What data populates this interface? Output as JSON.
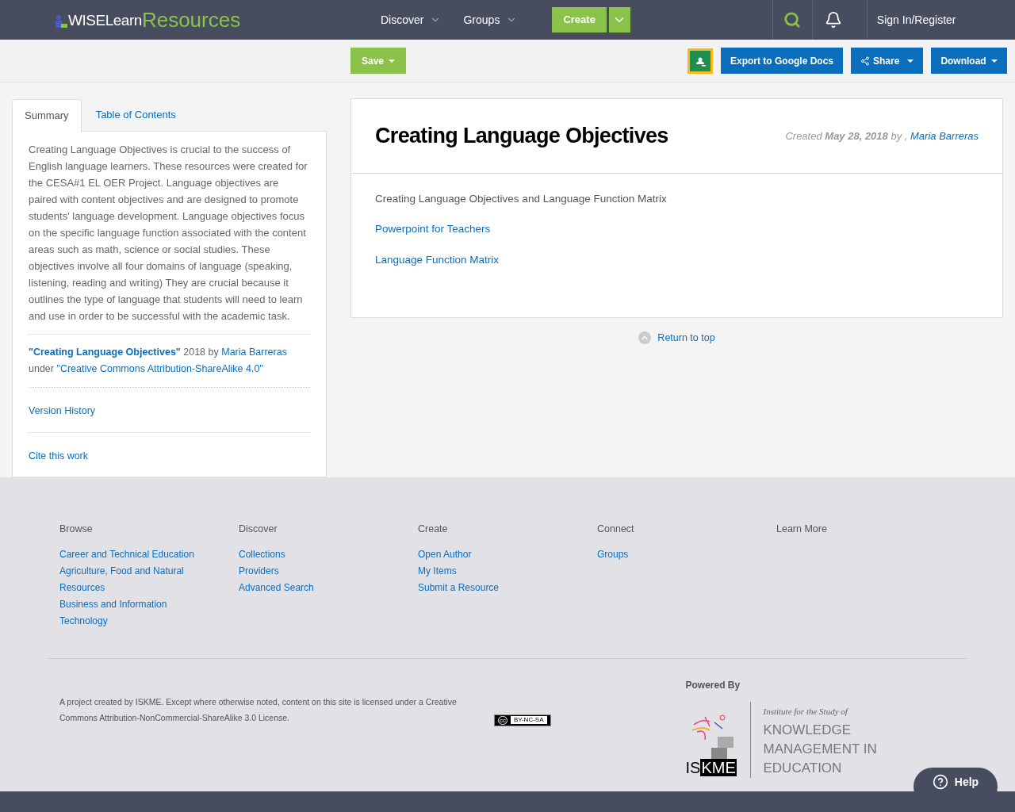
{
  "header": {
    "logo": {
      "part_1": "WISELearn",
      "part_2": "Resources"
    },
    "nav": [
      {
        "label": "Discover"
      },
      {
        "label": "Groups"
      }
    ],
    "create": "Create",
    "sign_in": "Sign In/Register"
  },
  "toolbar": {
    "save": "Save",
    "export": "Export to Google Docs",
    "share": "Share",
    "download": "Download"
  },
  "sidebar": {
    "tabs": [
      {
        "label": "Summary",
        "selected": true
      },
      {
        "label": "Table of Contents",
        "selected": false
      }
    ],
    "summary": "Creating Language Objectives is crucial to the success of English language learners. These resources were created for the CESA#1 EL OER Project. Language objectives are paired with content objectives and are designed to promote students' language development. Language objectives focus on the specific language function associated with the content areas such as math, science or social studies. These objectives involve all four domains of language (speaking, listening, reading and writing) They are crucial because it outlines the type of language that students will need to learn and use in order to be successful with the academic task.",
    "attribution": {
      "title": "\"Creating Language Objectives\"",
      "year_by": "2018 by",
      "author": "Maria Barreras",
      "under": "under",
      "license": "\"Creative Commons Attribution-ShareAlike 4.0\""
    },
    "links": [
      "Version History",
      "Cite this work"
    ]
  },
  "resource": {
    "title": "Creating Language Objectives",
    "created": "Created",
    "date": "May 28, 2018",
    "by": "by ,",
    "author": "Maria Barreras",
    "description": "Creating Language Objectives and Language Function Matrix",
    "links": [
      "Powerpoint for Teachers",
      "Language Function Matrix"
    ],
    "return_to_top": "Return to top"
  },
  "footer": {
    "columns": [
      {
        "heading": "Browse",
        "links": [
          "Career and Technical Education",
          "Agriculture, Food and Natural Resources",
          "Business and Information Technology"
        ]
      },
      {
        "heading": "Discover",
        "links": [
          "Collections",
          "Providers",
          "Advanced Search"
        ]
      },
      {
        "heading": "Create",
        "links": [
          "Open Author",
          "My Items",
          "Submit a Resource"
        ]
      },
      {
        "heading": "Connect",
        "links": [
          "Groups"
        ]
      },
      {
        "heading": "Learn More"
      }
    ],
    "license_text": "A project created by ISKME. Except where otherwise noted, content on this site is licensed under a Creative Commons Attribution-NonCommercial-ShareAlike 3.0 License.",
    "cc_badge": {
      "cc": "cc",
      "terms": "BY-NC-SA"
    },
    "powered_by": "Powered By",
    "iskme": {
      "mark_1": "IS",
      "mark_2": "KME",
      "tagline": "Institute for the Study of",
      "name": "KNOWLEDGE MANAGEMENT IN EDUCATION"
    },
    "help": "Help"
  }
}
